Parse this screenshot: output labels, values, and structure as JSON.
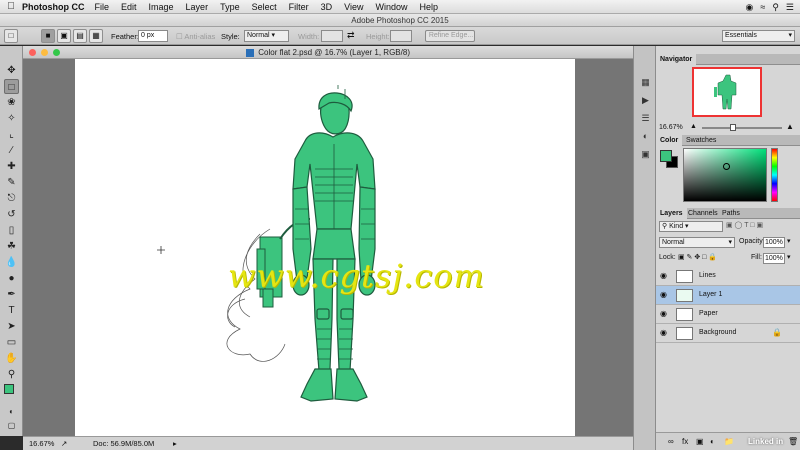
{
  "menubar": {
    "app_name": "Photoshop CC",
    "items": [
      "File",
      "Edit",
      "Image",
      "Layer",
      "Type",
      "Select",
      "Filter",
      "3D",
      "View",
      "Window",
      "Help"
    ]
  },
  "window_title": "Adobe Photoshop CC 2015",
  "options": {
    "feather_label": "Feather:",
    "feather_value": "0 px",
    "anti_alias_label": "Anti-alias",
    "style_label": "Style:",
    "style_value": "Normal",
    "width_label": "Width:",
    "height_label": "Height:",
    "refine_edge_label": "Refine Edge...",
    "workspace_value": "Essentials"
  },
  "document_title": "Color flat 2.psd @ 16.7% (Layer 1, RGB/8)",
  "watermark_text": "www.cgtsj.com",
  "status": {
    "zoom": "16.67%",
    "doc_info": "Doc: 56.9M/85.0M"
  },
  "navigator": {
    "tab_label": "Navigator",
    "zoom": "16.67%"
  },
  "color_panel": {
    "tabs": [
      "Color",
      "Swatches"
    ],
    "foreground_color": "#3cc47e",
    "background_color": "#000000"
  },
  "layers_panel": {
    "tabs": [
      "Layers",
      "Channels",
      "Paths"
    ],
    "kind_label": "Kind",
    "blend_mode": "Normal",
    "opacity_label": "Opacity:",
    "opacity_value": "100%",
    "lock_label": "Lock:",
    "fill_label": "Fill:",
    "fill_value": "100%",
    "layers": [
      {
        "name": "Lines",
        "selected": false
      },
      {
        "name": "Layer 1",
        "selected": true
      },
      {
        "name": "Paper",
        "selected": false
      },
      {
        "name": "Background",
        "selected": false
      }
    ]
  },
  "watermark_corner": "Linked in",
  "colors": {
    "character_fill": "#3cc47e",
    "character_line": "#1e5c3e",
    "selection_highlight": "#a9c6e6"
  }
}
